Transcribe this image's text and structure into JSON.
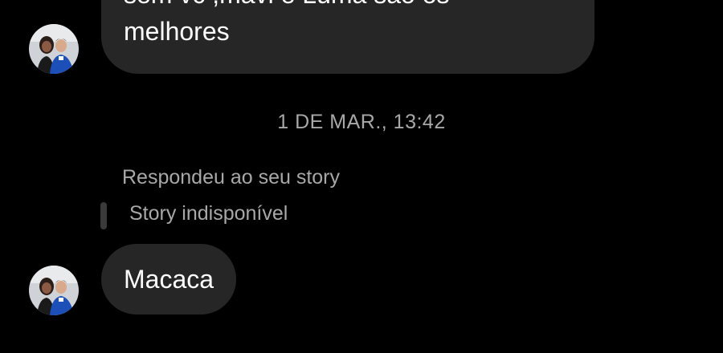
{
  "conversation": {
    "messages_before": {
      "text_line1": "sem vc ,mavi e Luma são os",
      "text_line2": "melhores"
    },
    "timestamp": "1 DE MAR., 13:42",
    "story_reply": {
      "label": "Respondeu ao seu story",
      "story_status": "Story indisponível"
    },
    "last_message": {
      "text": "Macaca"
    }
  },
  "colors": {
    "background": "#000000",
    "bubble": "#262626",
    "secondary_text": "#a8a8a8",
    "primary_text": "#ffffff"
  },
  "icons": {
    "avatar": "profile-photo"
  }
}
